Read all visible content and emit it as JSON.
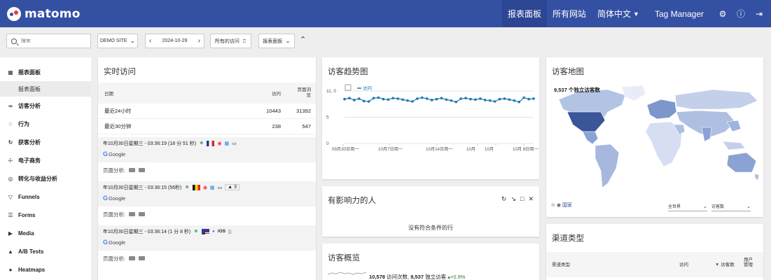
{
  "header": {
    "brand": "matomo",
    "nav": [
      {
        "label": "报表面板",
        "active": true
      },
      {
        "label": "所有网站",
        "active": false
      },
      {
        "label": "简体中文",
        "active": false,
        "dropdown": true
      },
      {
        "label": "Tag Manager",
        "active": false
      }
    ],
    "icons": [
      "gear-icon",
      "info-icon",
      "logout-icon"
    ]
  },
  "controls": {
    "search_placeholder": "搜索",
    "site": "DEMO SITE",
    "date": "2024-10-29",
    "segment": "所有的访问",
    "dashboard": "报表面板"
  },
  "sidebar": {
    "items": [
      {
        "label": "报表面板",
        "icon": "grid-icon"
      },
      {
        "label": "报表面板",
        "sub": true
      },
      {
        "label": "访客分析",
        "icon": "link-icon"
      },
      {
        "label": "行为",
        "icon": "bell-icon"
      },
      {
        "label": "获客分析",
        "icon": "refresh-icon"
      },
      {
        "label": "电子商务",
        "icon": "cart-icon"
      },
      {
        "label": "转化与收益分析",
        "icon": "target-icon"
      },
      {
        "label": "Funnels",
        "icon": "funnel-icon"
      },
      {
        "label": "Forms",
        "icon": "form-icon"
      },
      {
        "label": "Media",
        "icon": "media-icon"
      },
      {
        "label": "A/B Tests",
        "icon": "flask-icon"
      },
      {
        "label": "Heatmaps",
        "icon": "flame-icon"
      }
    ]
  },
  "realtime": {
    "title": "实时访问",
    "col_date": "日期",
    "col_visits": "访问",
    "col_pageviews": "页面浏览",
    "rows": [
      {
        "label": "最近24小时",
        "visits": "10443",
        "pageviews": "31392"
      },
      {
        "label": "最近30分钟",
        "visits": "238",
        "pageviews": "547"
      }
    ],
    "visits": [
      {
        "time": "年10月30日星期三 - 03:36:19 (18 分 51 秒)",
        "referrer": "Google",
        "pa_label": "页面分析:",
        "extra": ""
      },
      {
        "time": "年10月30日星期三 - 03:36:15 (56秒)",
        "referrer": "Google",
        "pa_label": "页面分析:",
        "extra": "3"
      },
      {
        "time": "年10月30日星期三 - 03:36:14 (1 分 8 秒)",
        "referrer": "Google",
        "pa_label": "页面分析:",
        "extra": "iOS"
      }
    ]
  },
  "trend": {
    "title": "访客趋势图",
    "legend": "访问",
    "chart_data": {
      "type": "line",
      "title": "访客趋势图",
      "series": [
        {
          "name": "访问",
          "values": [
            9.3,
            9.5,
            9.1,
            9.4,
            8.9,
            8.8,
            9.5,
            9.6,
            9.3,
            9.2,
            9.5,
            9.4,
            9.2,
            9.0,
            8.8,
            9.4,
            9.6,
            9.4,
            9.1,
            9.3,
            9.5,
            9.2,
            9.0,
            8.7,
            9.4,
            9.5,
            9.3,
            9.2,
            9.4,
            9.1,
            9.0,
            8.8,
            9.3,
            9.4,
            9.2,
            9.0,
            8.7,
            9.6,
            9.3,
            9.4
          ]
        }
      ],
      "ylim": [
        0,
        11
      ],
      "yticks": [
        "11, 0",
        "5",
        "0"
      ],
      "xticks": [
        "09月30日周一",
        "10月7日周一",
        "10月14日周一",
        "10月",
        "10月",
        "10月 8日周一"
      ]
    }
  },
  "influencers": {
    "title": "有影响力的人",
    "empty": "没有符合条件的行"
  },
  "overview": {
    "title": "访客概览",
    "summary_visits": "10,578",
    "summary_visits_label": "访问次数,",
    "summary_unique": "9,537",
    "summary_unique_label": "独立访客",
    "summary_change": "+0.9%"
  },
  "map": {
    "title": "访客地图",
    "visitors_label": "9,537 个独立访客数",
    "country_link": "国家",
    "region_select": "全世界",
    "metric_select": "访客数"
  },
  "channels": {
    "title": "渠道类型",
    "col_type": "渠道类型",
    "col_visits": "访问",
    "col_visitors": "访客数",
    "col_users": "用户管理"
  },
  "colors": {
    "accent": "#3450a3",
    "trend_line": "#1f77b4"
  }
}
